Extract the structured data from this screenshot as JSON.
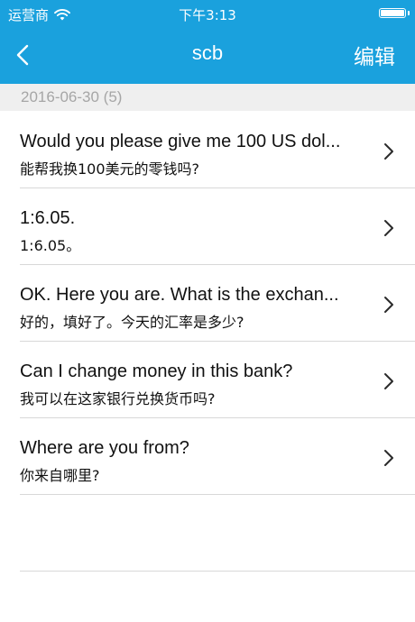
{
  "status_bar": {
    "carrier": "运营商",
    "time": "下午3:13"
  },
  "nav": {
    "title": "scb",
    "edit_label": "编辑"
  },
  "section": {
    "header": "2016-06-30 (5)"
  },
  "items": [
    {
      "en": "Would you please give me 100 US dol...",
      "zh": "能帮我换100美元的零钱吗?"
    },
    {
      "en": "1:6.05.",
      "zh": "1:6.05。"
    },
    {
      "en": "OK. Here you are. What is the exchan...",
      "zh": "好的，填好了。今天的汇率是多少?"
    },
    {
      "en": "Can I change money in this bank?",
      "zh": "我可以在这家银行兑换货币吗?"
    },
    {
      "en": "Where are you from?",
      "zh": "你来自哪里?"
    }
  ],
  "colors": {
    "accent": "#1aa1dd",
    "section_bg": "#efefef",
    "section_text": "#a6a6a6",
    "divider": "#d8d8d8"
  },
  "icons": {
    "wifi": "wifi-icon",
    "battery": "battery-icon",
    "back": "chevron-left-icon",
    "row": "chevron-right-icon"
  }
}
